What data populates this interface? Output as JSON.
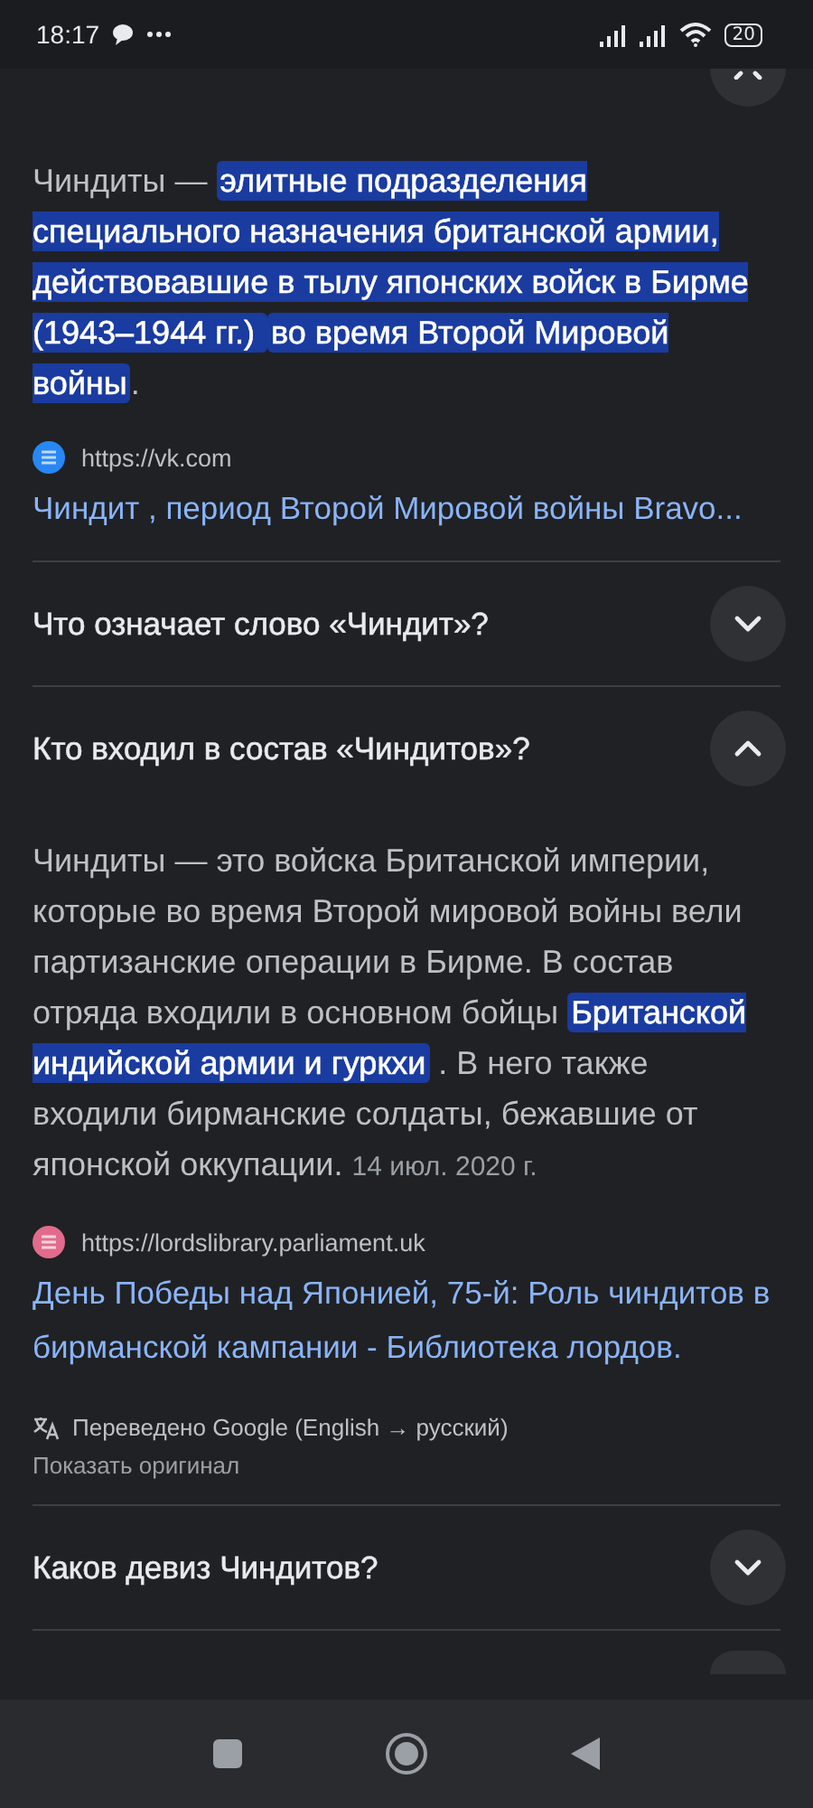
{
  "status_bar": {
    "time": "18:17",
    "battery": "20"
  },
  "faq": [
    {
      "kind": "cut_top",
      "expanded": true,
      "answer": [
        {
          "kind": "plain",
          "text": "Чиндиты — "
        },
        {
          "kind": "highlight",
          "text": "элитные подразделения специального назначения британской армии, действовавшие в тылу японских войск в Бирме (1943–1944 гг.) "
        },
        {
          "kind": "highlight",
          "text": "во время Второй Мировой войны"
        },
        {
          "kind": "plain",
          "text": "."
        }
      ],
      "source": {
        "color": "#2787f5",
        "url": "https://vk.com",
        "title": "Чиндит , период Второй Мировой войны Bravo..."
      }
    },
    {
      "kind": "full",
      "question": "Что означает слово «Чиндит»?",
      "expanded": false
    },
    {
      "kind": "full",
      "question": "Кто входил в состав «Чиндитов»?",
      "expanded": true,
      "answer": [
        {
          "kind": "plain",
          "text": "Чиндиты — это войска Британской империи, которые во время Второй мировой войны вели партизанские операции в Бирме. В состав отряда входили в основном бойцы "
        },
        {
          "kind": "highlight",
          "text": "Британской индийской армии и гуркхи"
        },
        {
          "kind": "plain",
          "text": " . В него также входили бирманские солдаты, бежавшие от японской оккупации. "
        },
        {
          "kind": "date",
          "text": "14 июл. 2020 г."
        }
      ],
      "source": {
        "color": "#e26b8c",
        "url": "https://lordslibrary.parliament.uk",
        "title": "День Победы над Японией, 75-й: Роль чиндитов в бирманской кампании - Библиотека лордов."
      },
      "translation": {
        "note": "Переведено Google (English → русский)",
        "action": "Показать оригинал"
      }
    },
    {
      "kind": "full",
      "question": "Каков девиз Чиндитов?",
      "expanded": false
    },
    {
      "kind": "cut_bottom"
    }
  ]
}
